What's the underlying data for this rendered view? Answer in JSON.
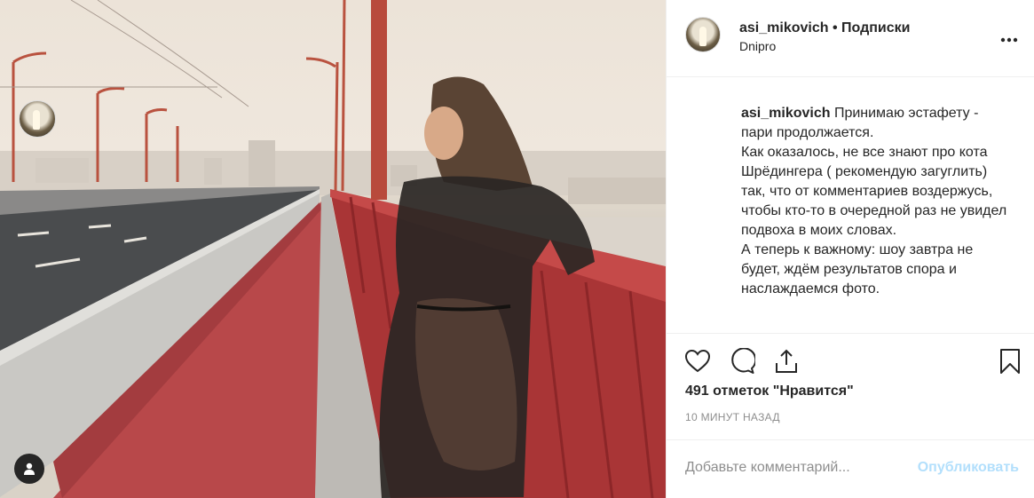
{
  "header": {
    "username": "asi_mikovich",
    "separator": "•",
    "follow_label": "Подписки",
    "location": "Dnipro",
    "more_icon": "more-horizontal-icon"
  },
  "caption": {
    "username": "asi_mikovich",
    "text": " Принимаю эстафету - пари продолжается.\nКак оказалось, не все знают про кота Шрёдингера ( рекомендую загуглить) так, что от комментариев воздержусь, чтобы кто-то в очередной раз не увидел подвоха в моих словах.\nА теперь к важному: шоу завтра не будет, ждём результатов спора и наслаждаемся фото."
  },
  "actions": {
    "like_icon": "heart-icon",
    "comment_icon": "comment-icon",
    "share_icon": "share-icon",
    "save_icon": "bookmark-icon"
  },
  "likes": "491 отметок \"Нравится\"",
  "timestamp": "10 МИНУТ НАЗАД",
  "comment": {
    "placeholder": "Добавьте комментарий...",
    "publish_label": "Опубликовать"
  },
  "photo": {
    "tag_icon": "user-tag-icon"
  },
  "colors": {
    "publish_disabled": "#b2dffc",
    "muted_text": "#8e8e8e",
    "divider": "#efefef"
  }
}
